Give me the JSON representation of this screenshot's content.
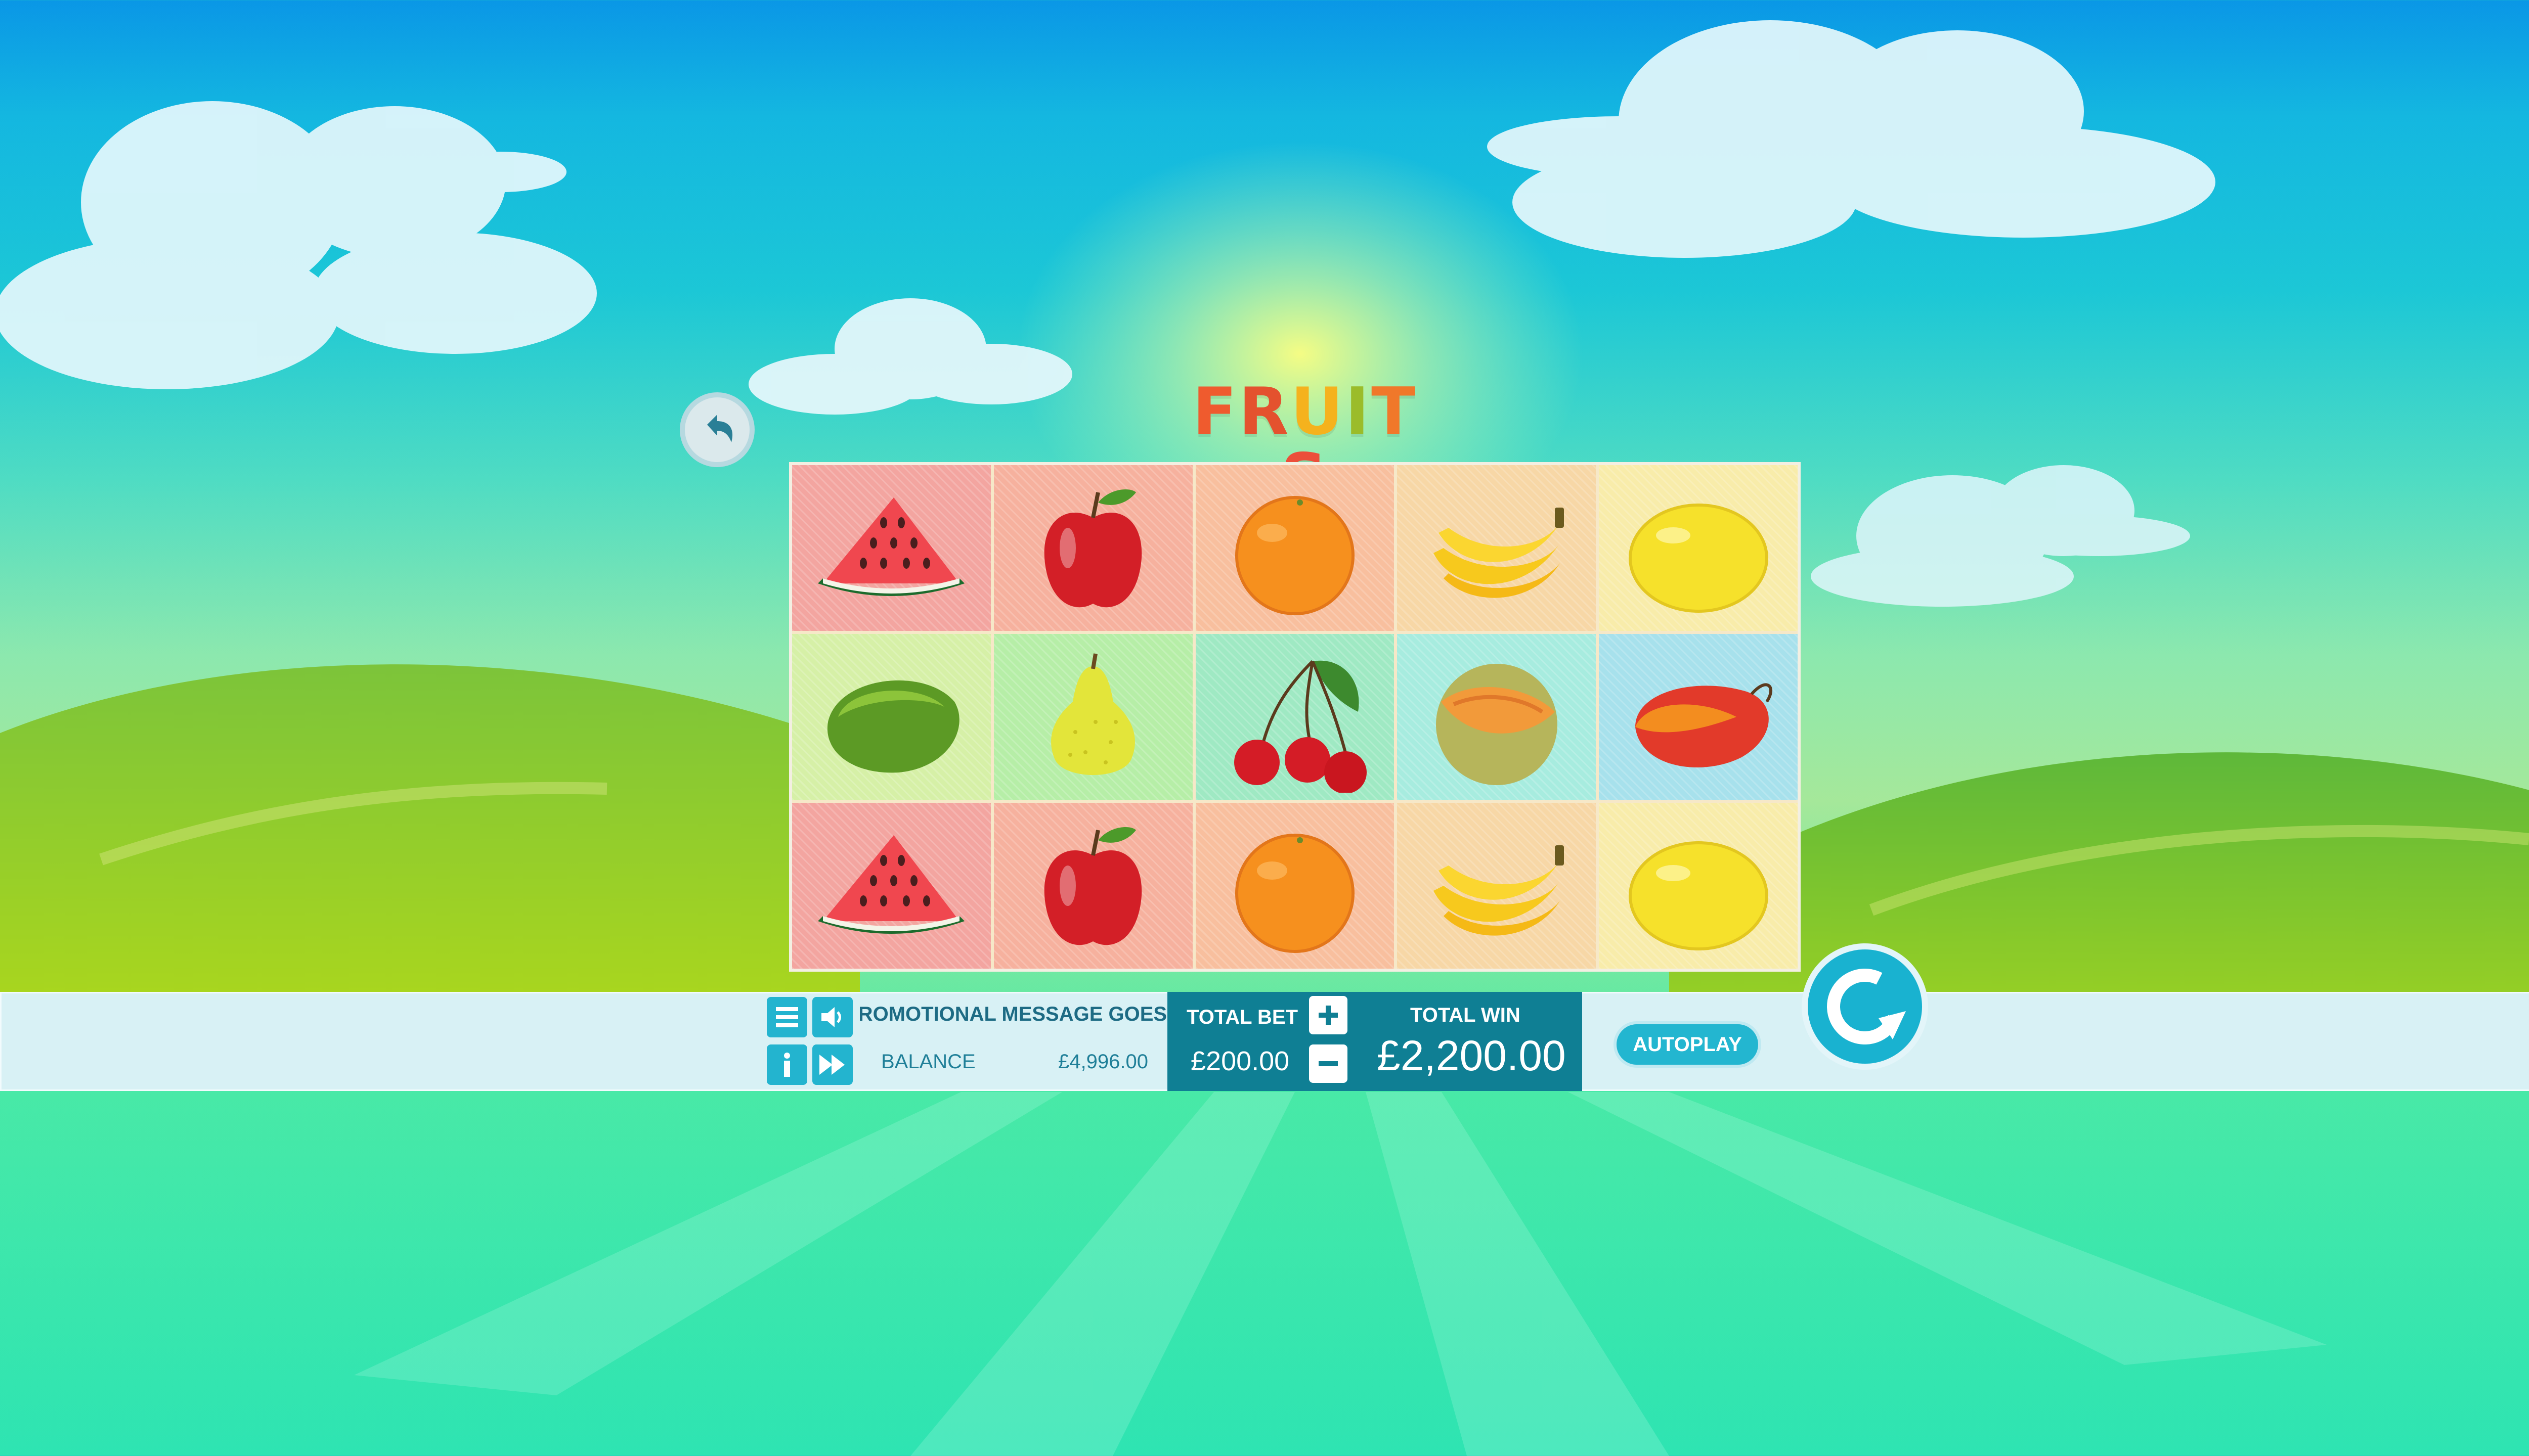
{
  "game": {
    "title_letters": [
      "F",
      "R",
      "U",
      "I",
      "T",
      "S"
    ]
  },
  "reels": {
    "rows": [
      [
        "watermelon",
        "apple",
        "orange",
        "banana",
        "lemon"
      ],
      [
        "papaya",
        "pear",
        "cherry",
        "cantaloupe",
        "mango"
      ],
      [
        "watermelon",
        "apple",
        "orange",
        "banana",
        "lemon"
      ]
    ],
    "cell_colors": [
      [
        "#f3a5a0",
        "#f6b19e",
        "#f8bf9e",
        "#f7d7a6",
        "#f8ecaa"
      ],
      [
        "#d6f0a7",
        "#b6eea7",
        "#9fe9c3",
        "#a7ecdf",
        "#a7e1ec"
      ],
      [
        "#f3a5a0",
        "#f6b19e",
        "#f8bf9e",
        "#f7d7a6",
        "#f8ecaa"
      ]
    ]
  },
  "controls": {
    "menu_icon": "menu-icon",
    "sound_icon": "speaker-icon",
    "info_icon": "info-icon",
    "fast_icon": "fast-forward-icon",
    "promo_message": "PROMOTIONAL MESSAGE GOES HERE",
    "balance_label": "BALANCE",
    "balance_value": "£4,996.00",
    "total_bet_label": "TOTAL BET",
    "total_bet_value": "£200.00",
    "total_win_label": "TOTAL WIN",
    "total_win_value": "£2,200.00",
    "autoplay_label": "AUTOPLAY"
  },
  "colors": {
    "accent": "#19b2d0",
    "panel_dark": "#0f7f94",
    "bar_bg": "#d8f1f5"
  }
}
